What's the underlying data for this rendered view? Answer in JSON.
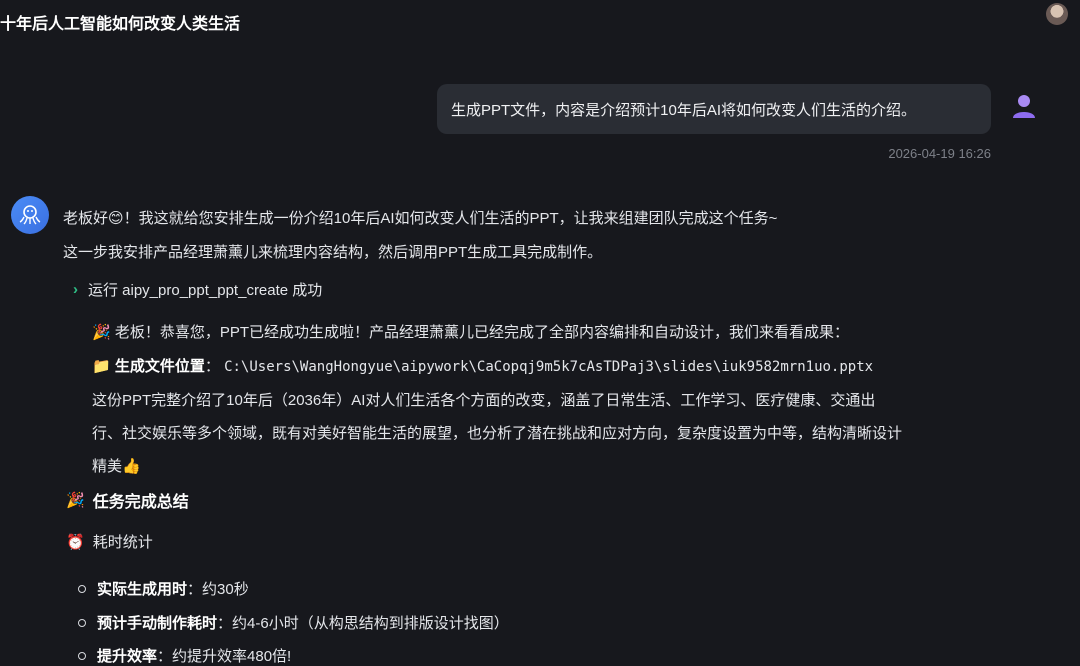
{
  "header": {
    "title": "十年后人工智能如何改变人类生活"
  },
  "user_message": {
    "text": "生成PPT文件，内容是介绍预计10年后AI将如何改变人们生活的介绍。",
    "timestamp": "2026-04-19 16:26"
  },
  "bot_message": {
    "line1": "老板好😊！我这就给您安排生成一份介绍10年后AI如何改变人们生活的PPT，让我来组建团队完成这个任务~",
    "line2": "这一步我安排产品经理萧薰儿来梳理内容结构，然后调用PPT生成工具完成制作。",
    "tool_run": "运行 aipy_pro_ppt_ppt_create 成功",
    "result_line1": "老板！恭喜您，PPT已经成功生成啦！产品经理萧薰儿已经完成了全部内容编排和自动设计，我们来看看成果：",
    "file_label": "生成文件位置",
    "file_sep": "：",
    "file_path": "C:\\Users\\WangHongyue\\aipywork\\CaCopqj9m5k7cAsTDPaj3\\slides\\iuk9582mrn1uo.pptx",
    "desc_line1": "这份PPT完整介绍了10年后（2036年）AI对人们生活各个方面的改变，涵盖了日常生活、工作学习、医疗健康、交通出",
    "desc_line2": "行、社交娱乐等多个领域，既有对美好智能生活的展望，也分析了潜在挑战和应对方向，复杂度设置为中等，结构清晰设计",
    "desc_line3": "精美👍",
    "summary_title": "任务完成总结",
    "time_stats": "耗时统计",
    "bullets": [
      {
        "label": "实际生成用时",
        "sep": "：",
        "value": "约30秒"
      },
      {
        "label": "预计手动制作耗时",
        "sep": "：",
        "value": "约4-6小时（从构思结构到排版设计找图）"
      },
      {
        "label": "提升效率",
        "sep": "：",
        "value": "约提升效率480倍!"
      }
    ]
  },
  "icons": {
    "party": "🎉",
    "folder": "📁",
    "clock": "⏰",
    "chevron": "›"
  }
}
